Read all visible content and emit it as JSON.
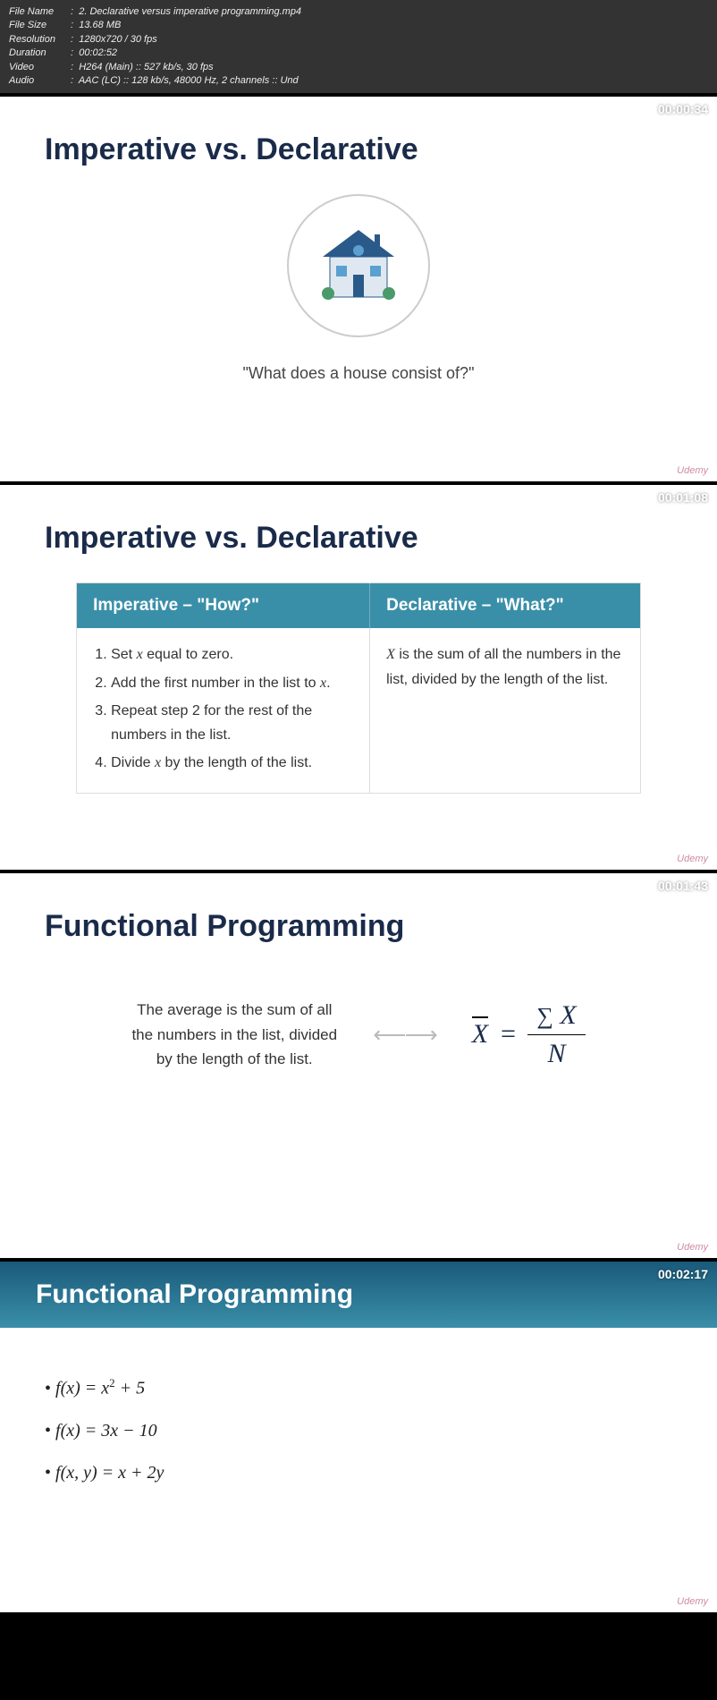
{
  "metadata": {
    "file_name_label": "File Name",
    "file_name": "2. Declarative versus imperative programming.mp4",
    "file_size_label": "File Size",
    "file_size": "13.68 MB",
    "resolution_label": "Resolution",
    "resolution": "1280x720 / 30 fps",
    "duration_label": "Duration",
    "duration": "00:02:52",
    "video_label": "Video",
    "video": "H264 (Main) :: 527 kb/s, 30 fps",
    "audio_label": "Audio",
    "audio": "AAC (LC) :: 128 kb/s, 48000 Hz, 2 channels :: Und"
  },
  "slides": [
    {
      "timestamp": "00:00:34",
      "title": "Imperative vs. Declarative",
      "caption": "\"What does a house consist of?\""
    },
    {
      "timestamp": "00:01:08",
      "title": "Imperative vs. Declarative",
      "table": {
        "header_left": "Imperative – \"How?\"",
        "header_right": "Declarative – \"What?\"",
        "left_items": [
          "Set x equal to zero.",
          "Add the first number in the list to x.",
          "Repeat step 2 for the rest of the numbers in the list.",
          "Divide x by the length of the list."
        ],
        "right_text": "X is the sum of all the numbers in the list, divided by the length of the list."
      }
    },
    {
      "timestamp": "00:01:43",
      "title": "Functional Programming",
      "desc": "The average is the sum of all the numbers in the list, divided by the length of the list.",
      "formula": {
        "lhs": "X",
        "eq": "=",
        "num": "∑ X",
        "den": "N"
      }
    },
    {
      "timestamp": "00:02:17",
      "title": "Functional Programming",
      "equations": [
        "f(x) = x² + 5",
        "f(x) = 3x − 10",
        "f(x, y) = x + 2y"
      ]
    }
  ],
  "watermark": "Udemy"
}
